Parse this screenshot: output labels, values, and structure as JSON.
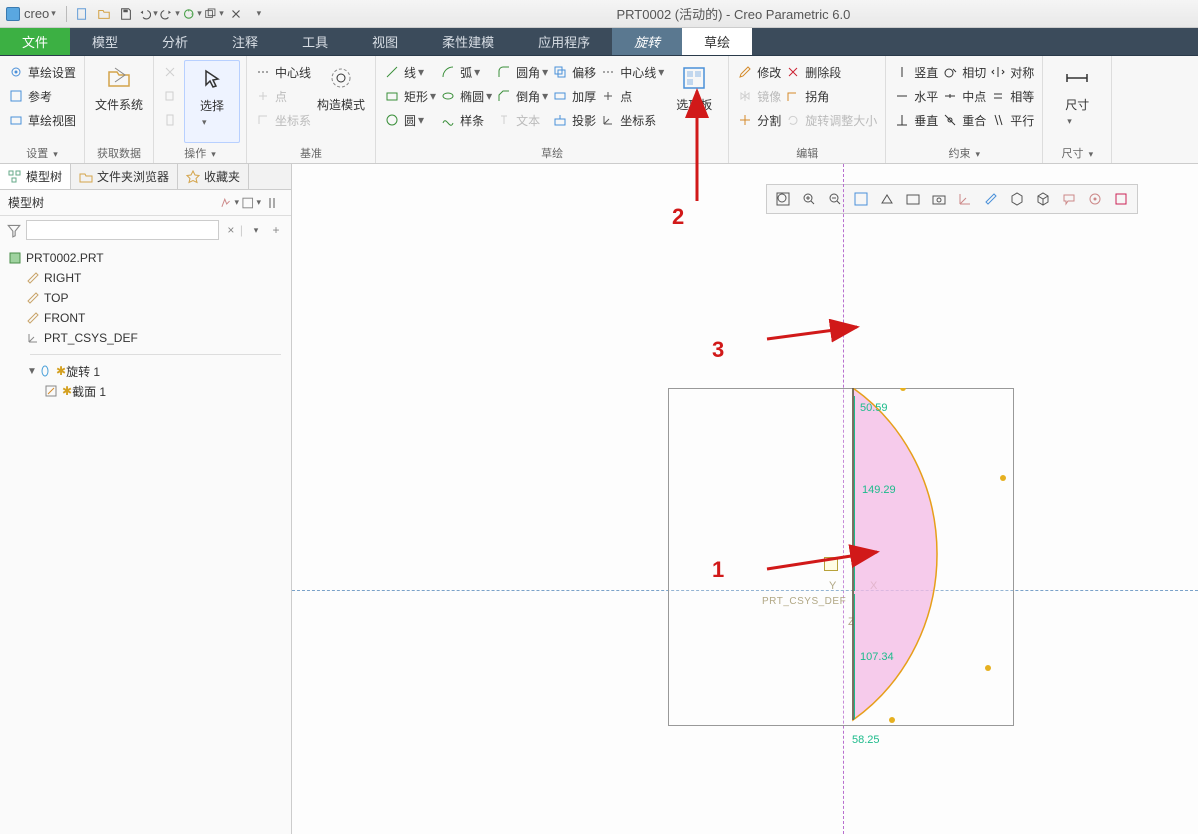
{
  "titlebar": {
    "brand": "creo",
    "title": "PRT0002 (活动的) - Creo Parametric 6.0"
  },
  "menu": {
    "file": "文件",
    "model": "模型",
    "analysis": "分析",
    "annotation": "注释",
    "tools": "工具",
    "view": "视图",
    "flex": "柔性建模",
    "app": "应用程序",
    "revolve": "旋转",
    "sketch": "草绘"
  },
  "ribbon": {
    "settings": {
      "g": "设置",
      "sketch_setup": "草绘设置",
      "ref": "参考",
      "sketch_view": "草绘视图"
    },
    "data": {
      "g": "获取数据",
      "filesystem": "文件系统"
    },
    "ops": {
      "g": "操作",
      "select": "选择"
    },
    "datum": {
      "g": "基准",
      "centerline": "中心线",
      "point": "点",
      "csys": "坐标系",
      "construct": "构造模式"
    },
    "sketch": {
      "g": "草绘",
      "line": "线",
      "arc": "弧",
      "fillet": "圆角",
      "offset": "偏移",
      "centerline2": "中心线",
      "rect": "矩形",
      "ellipse": "椭圆",
      "chamfer": "倒角",
      "thicken": "加厚",
      "point2": "点",
      "circle": "圆",
      "spline": "样条",
      "text": "文本",
      "project": "投影",
      "csys2": "坐标系",
      "palette": "选项板"
    },
    "edit": {
      "g": "编辑",
      "modify": "修改",
      "delseg": "删除段",
      "mirror": "镜像",
      "corner": "拐角",
      "divide": "分割",
      "rotresize": "旋转调整大小"
    },
    "constrain": {
      "g": "约束",
      "vert": "竖直",
      "tangent": "相切",
      "sym": "对称",
      "horiz": "水平",
      "mid": "中点",
      "equal": "相等",
      "perp": "垂直",
      "coinc": "重合",
      "parallel": "平行"
    },
    "dim": {
      "g": "尺寸",
      "dim": "尺寸"
    }
  },
  "panel": {
    "tabs": {
      "modeltree": "模型树",
      "folder": "文件夹浏览器",
      "fav": "收藏夹"
    },
    "header": "模型树",
    "tree": {
      "root": "PRT0002.PRT",
      "right": "RIGHT",
      "top": "TOP",
      "front": "FRONT",
      "csys": "PRT_CSYS_DEF",
      "revolve": "旋转 1",
      "section": "截面 1"
    }
  },
  "canvas": {
    "csys": "PRT_CSYS_DEF",
    "y": "Y",
    "x": "X",
    "z": "Z",
    "d1": "50.59",
    "d2": "149.29",
    "d3": "107.34",
    "d4": "58.25",
    "a1": "1",
    "a2": "2",
    "a3": "3"
  }
}
